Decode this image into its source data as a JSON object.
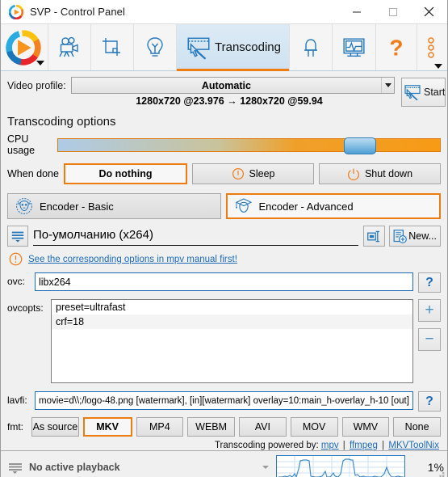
{
  "window": {
    "title": "SVP - Control Panel",
    "logo_icon": "svp-logo-icon",
    "minimize_label": "—",
    "maximize_label": "□",
    "close_label": "✕"
  },
  "toolbar": {
    "items": [
      {
        "name": "svp-logo",
        "icon": "svp-logo-icon",
        "label": ""
      },
      {
        "name": "movie",
        "icon": "movie-camera-icon",
        "label": ""
      },
      {
        "name": "crop",
        "icon": "crop-icon",
        "label": ""
      },
      {
        "name": "lightbulb",
        "icon": "lightbulb-icon",
        "label": ""
      },
      {
        "name": "transcoding",
        "icon": "filmstrip-cursor-icon",
        "label": "Transcoding",
        "active": true
      },
      {
        "name": "led",
        "icon": "led-icon",
        "label": ""
      },
      {
        "name": "monitor",
        "icon": "monitor-pulse-icon",
        "label": ""
      },
      {
        "name": "help",
        "icon": "question-mark-icon",
        "label": ""
      },
      {
        "name": "more",
        "icon": "three-dots-icon",
        "label": ""
      }
    ]
  },
  "video_profile": {
    "label": "Video profile:",
    "selected": "Automatic",
    "info": "1280x720 @23.976 → 1280x720 @59.94",
    "start_label": "Start",
    "start_icon": "filmstrip-cursor-icon",
    "stop_icon": "cross-icon"
  },
  "transcoding": {
    "section_title": "Transcoding options",
    "cpu_label": "CPU usage",
    "cpu_value": 79,
    "when_done_label": "When done",
    "when_done_options": [
      {
        "label": "Do nothing",
        "icon": "",
        "selected": true
      },
      {
        "label": "Sleep",
        "icon": "sleep-icon",
        "selected": false
      },
      {
        "label": "Shut down",
        "icon": "power-icon",
        "selected": false
      }
    ],
    "encoder_tabs": [
      {
        "label": "Encoder - Basic",
        "icon": "sheep-icon",
        "selected": false
      },
      {
        "label": "Encoder - Advanced",
        "icon": "graduation-cap-icon",
        "selected": true
      }
    ]
  },
  "profile": {
    "menu_icon": "hamburger-icon",
    "name": "По-умолчанию (x264)",
    "rename_icon": "rename-icon",
    "new_label": "New...",
    "new_icon": "new-profile-icon"
  },
  "warning": {
    "icon": "warning-circle-icon",
    "text": "See the corresponding options in mpv manual first!"
  },
  "fields": {
    "ovc_label": "ovc:",
    "ovc_value": "libx264",
    "ovc_help": "?",
    "ovcopts_label": "ovcopts:",
    "ovcopts_values": [
      "preset=ultrafast",
      "crf=18"
    ],
    "add_label": "+",
    "remove_label": "−",
    "lavfi_label": "lavfi:",
    "lavfi_value": "movie=d\\\\;/logo-48.png [watermark], [in][watermark] overlay=10:main_h-overlay_h-10 [out]",
    "lavfi_help": "?"
  },
  "format": {
    "label": "fmt:",
    "options": [
      {
        "label": "As source",
        "selected": false
      },
      {
        "label": "MKV",
        "selected": true
      },
      {
        "label": "MP4",
        "selected": false
      },
      {
        "label": "WEBM",
        "selected": false
      },
      {
        "label": "AVI",
        "selected": false
      },
      {
        "label": "MOV",
        "selected": false
      },
      {
        "label": "WMV",
        "selected": false
      },
      {
        "label": "None",
        "selected": false
      }
    ]
  },
  "powered_by": {
    "prefix": "Transcoding powered by:",
    "links": [
      "mpv",
      "ffmpeg",
      "MKVToolNix"
    ],
    "separator": "|"
  },
  "statusbar": {
    "menu_icon": "hamburger-icon",
    "text": "No active playback",
    "dropdown_icon": "chevron-down-icon",
    "graph_icon": "cpu-graph",
    "percent": "1%",
    "grip_icon": "resize-grip-icon"
  },
  "colors": {
    "accent_orange": "#ed7d10",
    "link_blue": "#1e6bb8",
    "icon_blue": "#2779bd",
    "window_bg": "#f0f0f0"
  }
}
